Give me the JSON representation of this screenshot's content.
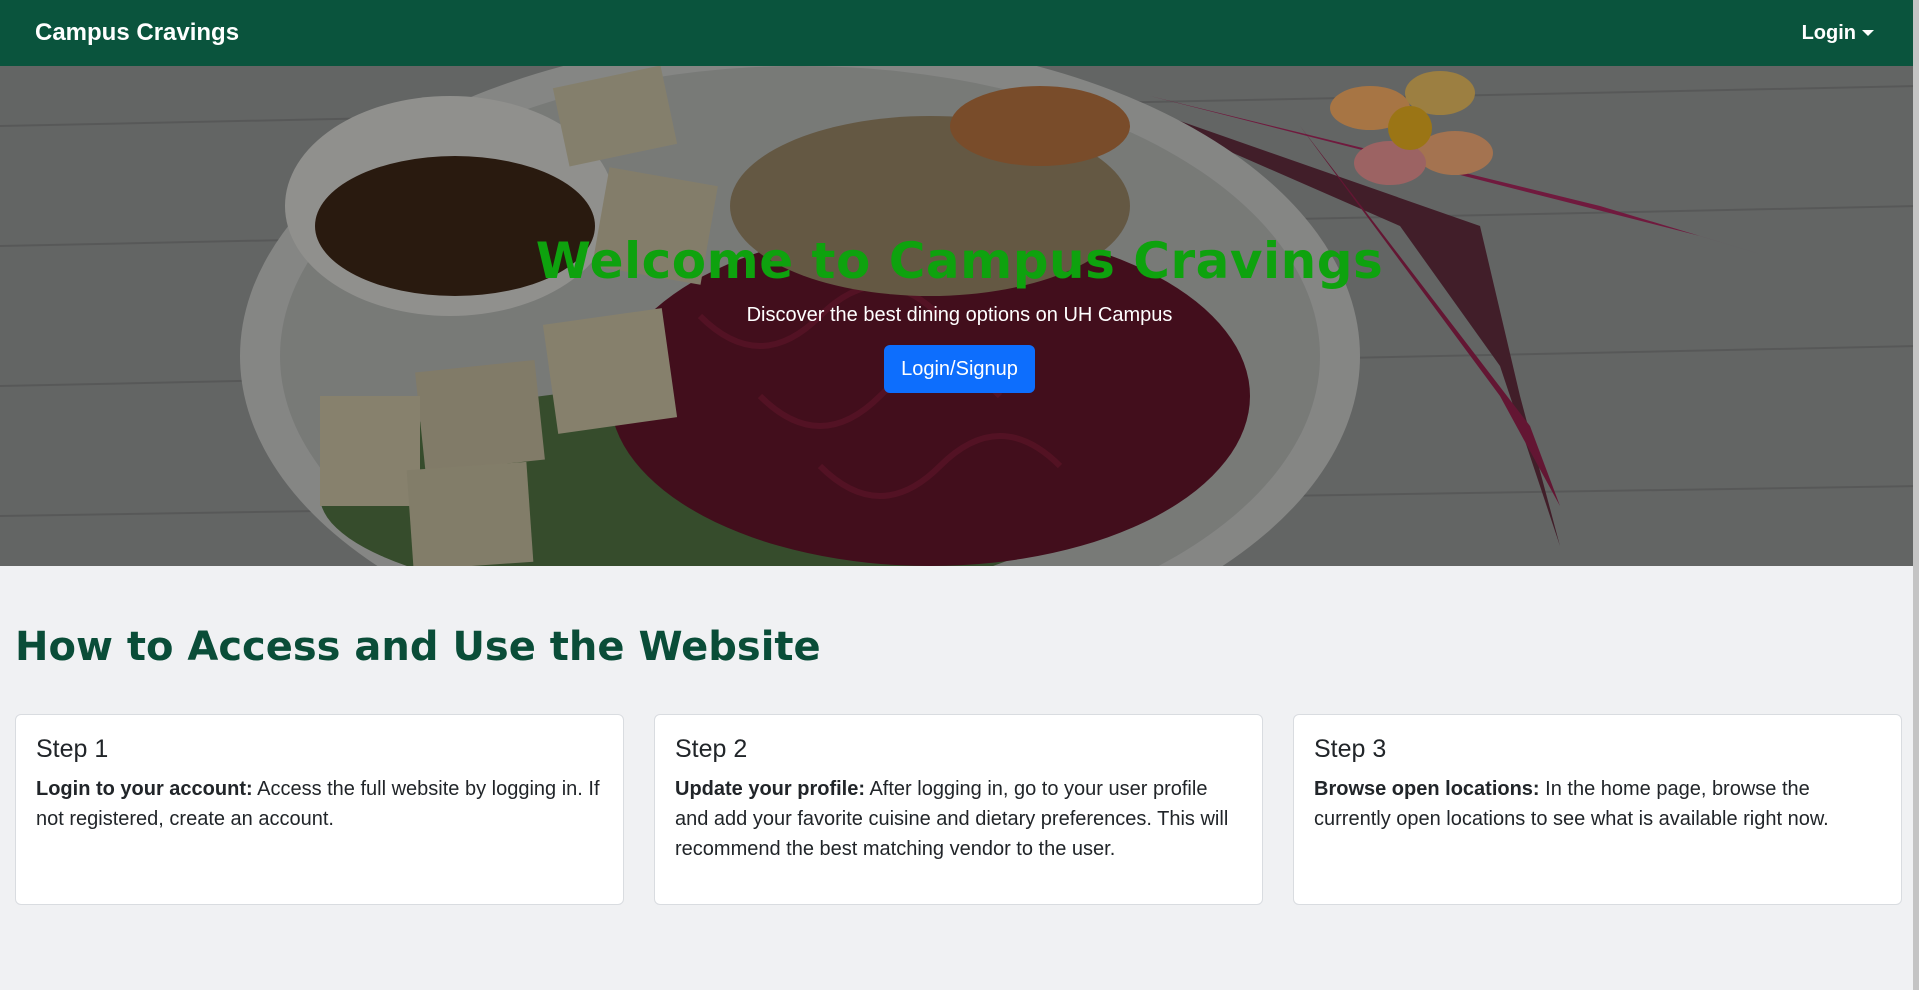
{
  "nav": {
    "brand": "Campus Cravings",
    "login_label": "Login"
  },
  "hero": {
    "title": "Welcome to Campus Cravings",
    "subtitle": "Discover the best dining options on UH Campus",
    "button_label": "Login/Signup"
  },
  "section": {
    "title": "How to Access and Use the Website"
  },
  "steps": [
    {
      "title": "Step 1",
      "lead": "Login to your account:",
      "text": " Access the full website by logging in. If not registered, create an account."
    },
    {
      "title": "Step 2",
      "lead": "Update your profile:",
      "text": " After logging in, go to your user profile and add your favorite cuisine and dietary preferences. This will recommend the best matching vendor to the user."
    },
    {
      "title": "Step 3",
      "lead": "Browse open locations:",
      "text": " In the home page, browse the currently open locations to see what is available right now."
    }
  ],
  "colors": {
    "navbar": "#0a543d",
    "hero_title": "#0ea20e",
    "primary_button": "#0d6efd",
    "section_title": "#0a4d38"
  }
}
